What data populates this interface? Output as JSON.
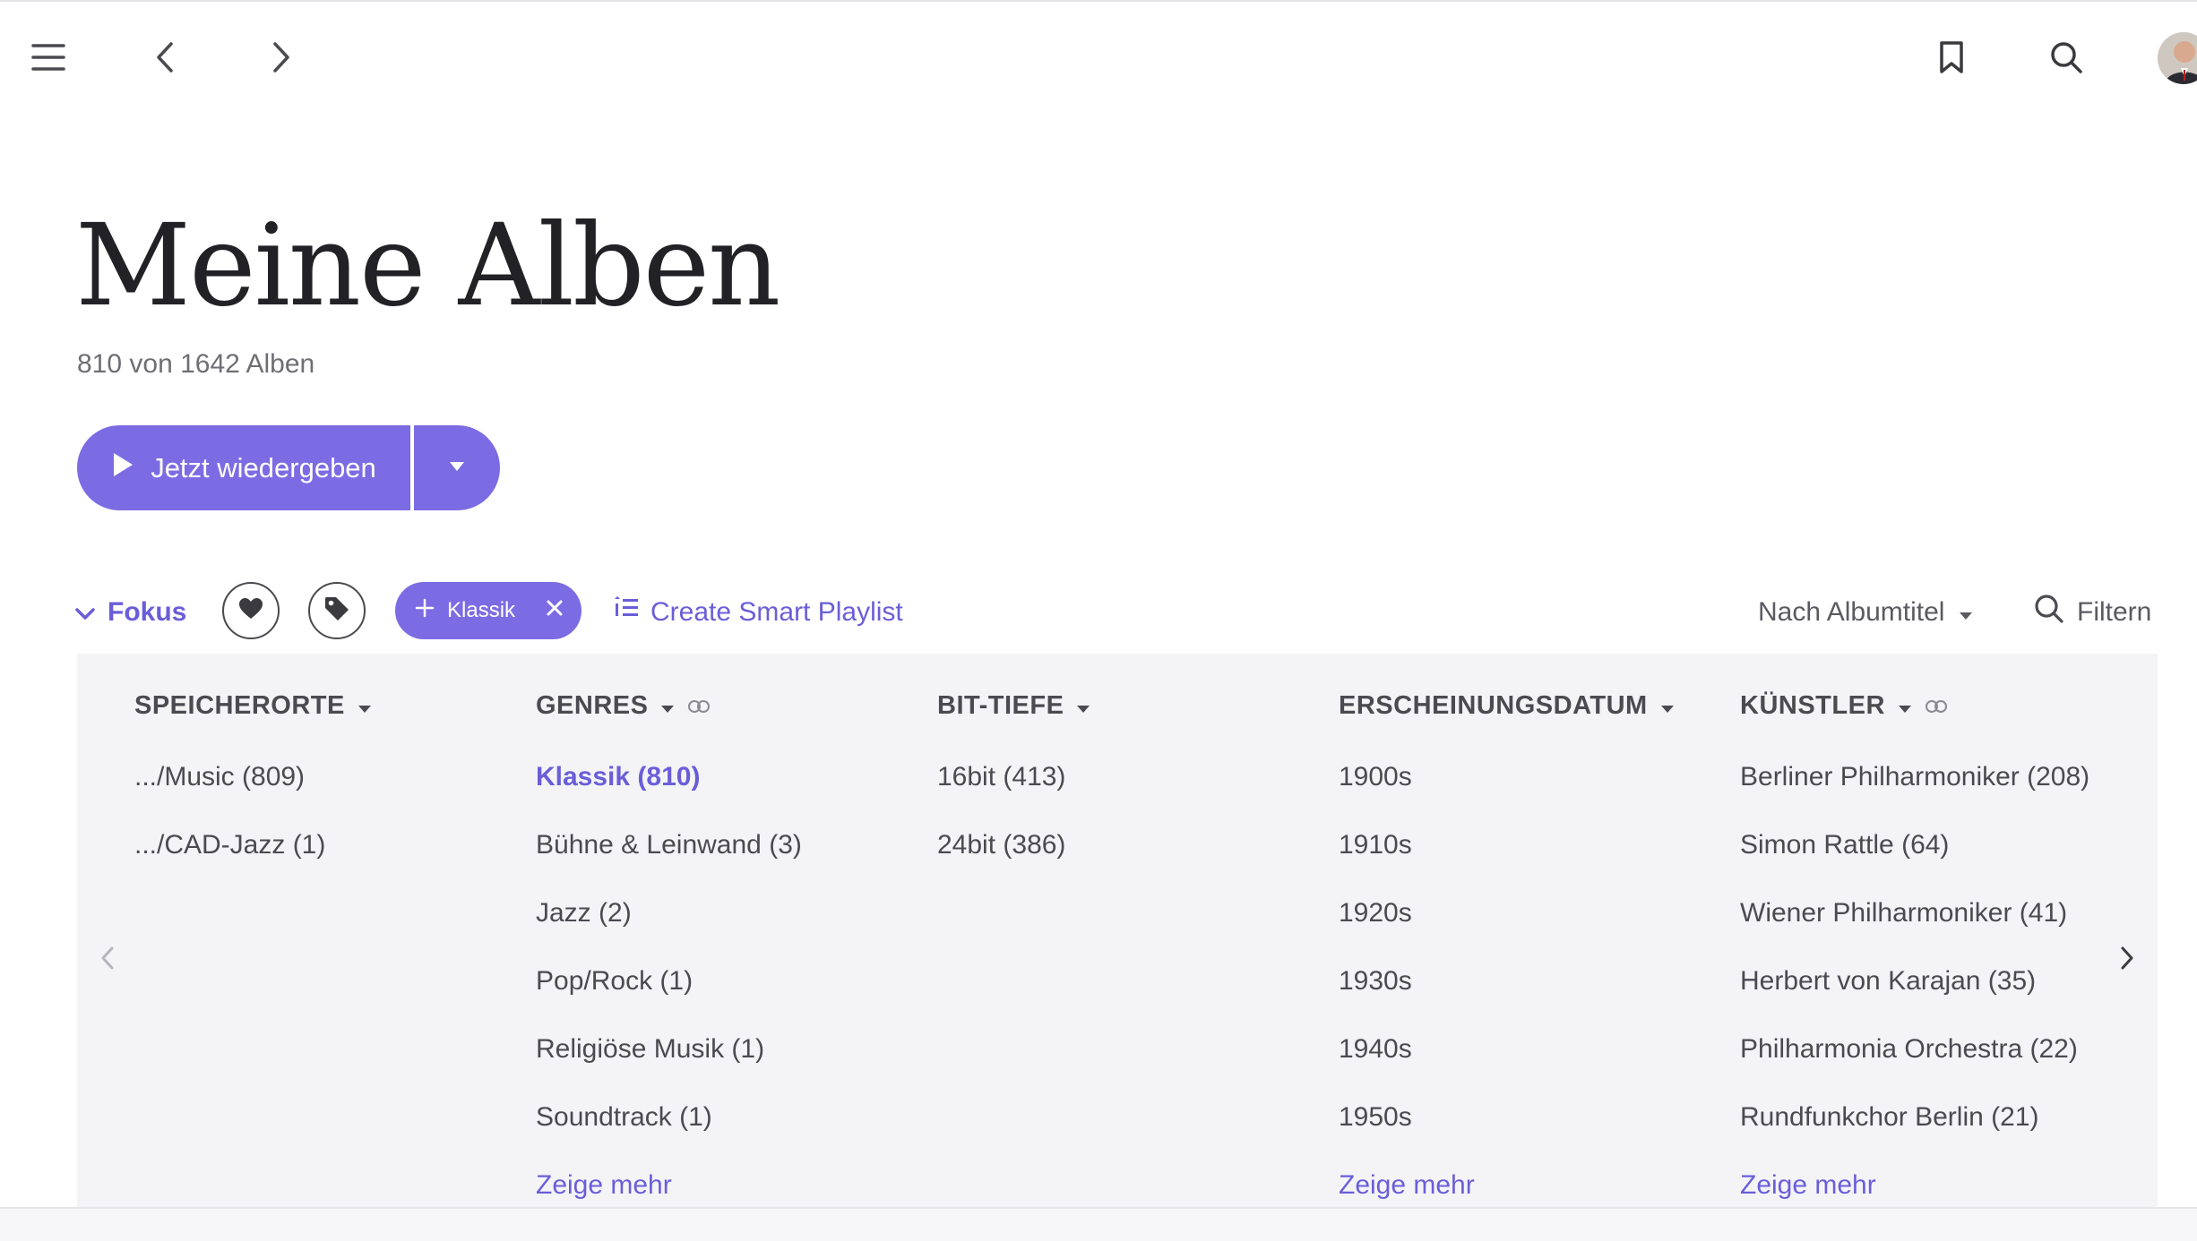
{
  "header": {
    "menu_icon": "hamburger-icon",
    "back_icon": "chevron-left-icon",
    "forward_icon": "chevron-right-icon",
    "bookmark_icon": "bookmark-icon",
    "search_icon": "search-icon"
  },
  "page": {
    "title": "Meine Alben",
    "count": "810 von 1642 Alben"
  },
  "actions": {
    "play_label": "Jetzt wiedergeben"
  },
  "filterbar": {
    "fokus_label": "Fokus",
    "chip_label": "Klassik",
    "smart_playlist_label": "Create Smart Playlist",
    "sort_label": "Nach Albumtitel",
    "filter_label": "Filtern"
  },
  "columns": {
    "storage": {
      "header": "SPEICHERORTE",
      "items": [
        ".../Music (809)",
        ".../CAD-Jazz (1)"
      ]
    },
    "genres": {
      "header": "GENRES",
      "items": [
        "Klassik (810)",
        "Bühne & Leinwand (3)",
        "Jazz (2)",
        "Pop/Rock (1)",
        "Religiöse Musik (1)",
        "Soundtrack (1)"
      ],
      "more": "Zeige mehr"
    },
    "bitdepth": {
      "header": "BIT-TIEFE",
      "items": [
        "16bit (413)",
        "24bit (386)"
      ]
    },
    "release": {
      "header": "ERSCHEINUNGSDATUM",
      "items": [
        "1900s",
        "1910s",
        "1920s",
        "1930s",
        "1940s",
        "1950s"
      ],
      "more": "Zeige mehr"
    },
    "artists": {
      "header": "KÜNSTLER",
      "items": [
        "Berliner Philharmoniker (208)",
        "Simon Rattle (64)",
        "Wiener Philharmoniker (41)",
        "Herbert von Karajan (35)",
        "Philharmonia Orchestra (22)",
        "Rundfunkchor Berlin (21)"
      ],
      "more": "Zeige mehr"
    }
  },
  "colors": {
    "accent": "#7b6ce4",
    "accent_text": "#6a5ed8",
    "panel_bg": "#f4f4f7"
  }
}
